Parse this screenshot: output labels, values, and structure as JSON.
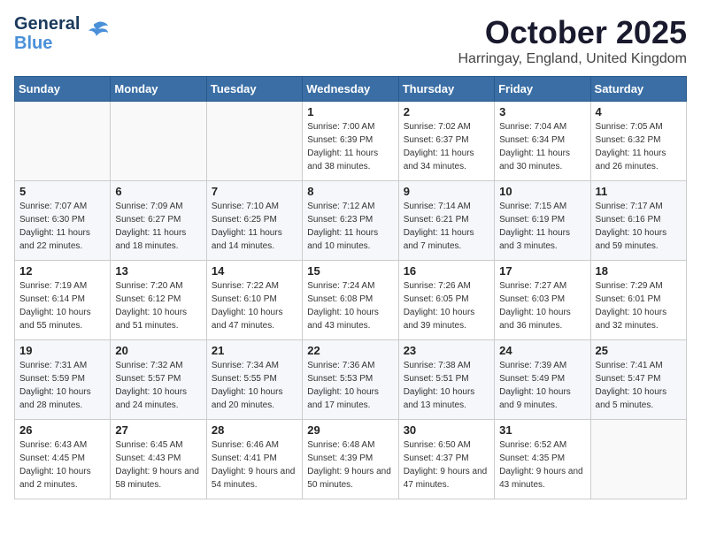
{
  "header": {
    "logo_general": "General",
    "logo_blue": "Blue",
    "month": "October 2025",
    "location": "Harringay, England, United Kingdom"
  },
  "days_of_week": [
    "Sunday",
    "Monday",
    "Tuesday",
    "Wednesday",
    "Thursday",
    "Friday",
    "Saturday"
  ],
  "weeks": [
    [
      {
        "day": "",
        "sunrise": "",
        "sunset": "",
        "daylight": ""
      },
      {
        "day": "",
        "sunrise": "",
        "sunset": "",
        "daylight": ""
      },
      {
        "day": "",
        "sunrise": "",
        "sunset": "",
        "daylight": ""
      },
      {
        "day": "1",
        "sunrise": "Sunrise: 7:00 AM",
        "sunset": "Sunset: 6:39 PM",
        "daylight": "Daylight: 11 hours and 38 minutes."
      },
      {
        "day": "2",
        "sunrise": "Sunrise: 7:02 AM",
        "sunset": "Sunset: 6:37 PM",
        "daylight": "Daylight: 11 hours and 34 minutes."
      },
      {
        "day": "3",
        "sunrise": "Sunrise: 7:04 AM",
        "sunset": "Sunset: 6:34 PM",
        "daylight": "Daylight: 11 hours and 30 minutes."
      },
      {
        "day": "4",
        "sunrise": "Sunrise: 7:05 AM",
        "sunset": "Sunset: 6:32 PM",
        "daylight": "Daylight: 11 hours and 26 minutes."
      }
    ],
    [
      {
        "day": "5",
        "sunrise": "Sunrise: 7:07 AM",
        "sunset": "Sunset: 6:30 PM",
        "daylight": "Daylight: 11 hours and 22 minutes."
      },
      {
        "day": "6",
        "sunrise": "Sunrise: 7:09 AM",
        "sunset": "Sunset: 6:27 PM",
        "daylight": "Daylight: 11 hours and 18 minutes."
      },
      {
        "day": "7",
        "sunrise": "Sunrise: 7:10 AM",
        "sunset": "Sunset: 6:25 PM",
        "daylight": "Daylight: 11 hours and 14 minutes."
      },
      {
        "day": "8",
        "sunrise": "Sunrise: 7:12 AM",
        "sunset": "Sunset: 6:23 PM",
        "daylight": "Daylight: 11 hours and 10 minutes."
      },
      {
        "day": "9",
        "sunrise": "Sunrise: 7:14 AM",
        "sunset": "Sunset: 6:21 PM",
        "daylight": "Daylight: 11 hours and 7 minutes."
      },
      {
        "day": "10",
        "sunrise": "Sunrise: 7:15 AM",
        "sunset": "Sunset: 6:19 PM",
        "daylight": "Daylight: 11 hours and 3 minutes."
      },
      {
        "day": "11",
        "sunrise": "Sunrise: 7:17 AM",
        "sunset": "Sunset: 6:16 PM",
        "daylight": "Daylight: 10 hours and 59 minutes."
      }
    ],
    [
      {
        "day": "12",
        "sunrise": "Sunrise: 7:19 AM",
        "sunset": "Sunset: 6:14 PM",
        "daylight": "Daylight: 10 hours and 55 minutes."
      },
      {
        "day": "13",
        "sunrise": "Sunrise: 7:20 AM",
        "sunset": "Sunset: 6:12 PM",
        "daylight": "Daylight: 10 hours and 51 minutes."
      },
      {
        "day": "14",
        "sunrise": "Sunrise: 7:22 AM",
        "sunset": "Sunset: 6:10 PM",
        "daylight": "Daylight: 10 hours and 47 minutes."
      },
      {
        "day": "15",
        "sunrise": "Sunrise: 7:24 AM",
        "sunset": "Sunset: 6:08 PM",
        "daylight": "Daylight: 10 hours and 43 minutes."
      },
      {
        "day": "16",
        "sunrise": "Sunrise: 7:26 AM",
        "sunset": "Sunset: 6:05 PM",
        "daylight": "Daylight: 10 hours and 39 minutes."
      },
      {
        "day": "17",
        "sunrise": "Sunrise: 7:27 AM",
        "sunset": "Sunset: 6:03 PM",
        "daylight": "Daylight: 10 hours and 36 minutes."
      },
      {
        "day": "18",
        "sunrise": "Sunrise: 7:29 AM",
        "sunset": "Sunset: 6:01 PM",
        "daylight": "Daylight: 10 hours and 32 minutes."
      }
    ],
    [
      {
        "day": "19",
        "sunrise": "Sunrise: 7:31 AM",
        "sunset": "Sunset: 5:59 PM",
        "daylight": "Daylight: 10 hours and 28 minutes."
      },
      {
        "day": "20",
        "sunrise": "Sunrise: 7:32 AM",
        "sunset": "Sunset: 5:57 PM",
        "daylight": "Daylight: 10 hours and 24 minutes."
      },
      {
        "day": "21",
        "sunrise": "Sunrise: 7:34 AM",
        "sunset": "Sunset: 5:55 PM",
        "daylight": "Daylight: 10 hours and 20 minutes."
      },
      {
        "day": "22",
        "sunrise": "Sunrise: 7:36 AM",
        "sunset": "Sunset: 5:53 PM",
        "daylight": "Daylight: 10 hours and 17 minutes."
      },
      {
        "day": "23",
        "sunrise": "Sunrise: 7:38 AM",
        "sunset": "Sunset: 5:51 PM",
        "daylight": "Daylight: 10 hours and 13 minutes."
      },
      {
        "day": "24",
        "sunrise": "Sunrise: 7:39 AM",
        "sunset": "Sunset: 5:49 PM",
        "daylight": "Daylight: 10 hours and 9 minutes."
      },
      {
        "day": "25",
        "sunrise": "Sunrise: 7:41 AM",
        "sunset": "Sunset: 5:47 PM",
        "daylight": "Daylight: 10 hours and 5 minutes."
      }
    ],
    [
      {
        "day": "26",
        "sunrise": "Sunrise: 6:43 AM",
        "sunset": "Sunset: 4:45 PM",
        "daylight": "Daylight: 10 hours and 2 minutes."
      },
      {
        "day": "27",
        "sunrise": "Sunrise: 6:45 AM",
        "sunset": "Sunset: 4:43 PM",
        "daylight": "Daylight: 9 hours and 58 minutes."
      },
      {
        "day": "28",
        "sunrise": "Sunrise: 6:46 AM",
        "sunset": "Sunset: 4:41 PM",
        "daylight": "Daylight: 9 hours and 54 minutes."
      },
      {
        "day": "29",
        "sunrise": "Sunrise: 6:48 AM",
        "sunset": "Sunset: 4:39 PM",
        "daylight": "Daylight: 9 hours and 50 minutes."
      },
      {
        "day": "30",
        "sunrise": "Sunrise: 6:50 AM",
        "sunset": "Sunset: 4:37 PM",
        "daylight": "Daylight: 9 hours and 47 minutes."
      },
      {
        "day": "31",
        "sunrise": "Sunrise: 6:52 AM",
        "sunset": "Sunset: 4:35 PM",
        "daylight": "Daylight: 9 hours and 43 minutes."
      },
      {
        "day": "",
        "sunrise": "",
        "sunset": "",
        "daylight": ""
      }
    ]
  ]
}
